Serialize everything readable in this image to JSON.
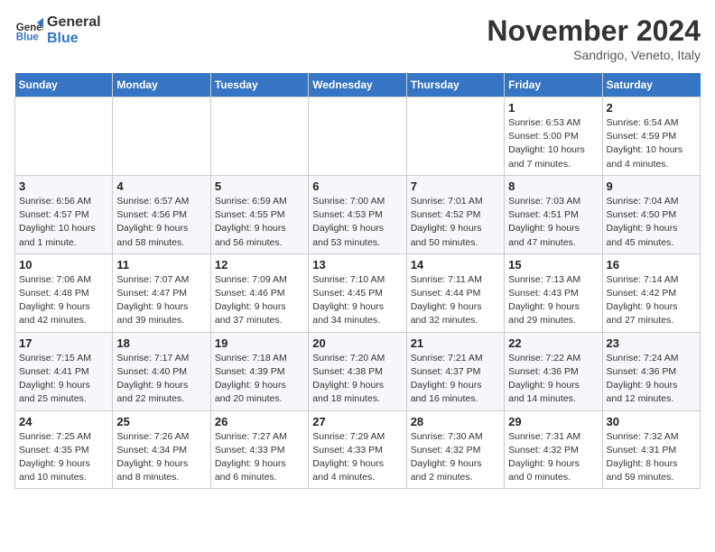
{
  "logo": {
    "line1": "General",
    "line2": "Blue"
  },
  "title": "November 2024",
  "location": "Sandrigo, Veneto, Italy",
  "weekdays": [
    "Sunday",
    "Monday",
    "Tuesday",
    "Wednesday",
    "Thursday",
    "Friday",
    "Saturday"
  ],
  "weeks": [
    [
      {
        "day": "",
        "info": ""
      },
      {
        "day": "",
        "info": ""
      },
      {
        "day": "",
        "info": ""
      },
      {
        "day": "",
        "info": ""
      },
      {
        "day": "",
        "info": ""
      },
      {
        "day": "1",
        "info": "Sunrise: 6:53 AM\nSunset: 5:00 PM\nDaylight: 10 hours\nand 7 minutes."
      },
      {
        "day": "2",
        "info": "Sunrise: 6:54 AM\nSunset: 4:59 PM\nDaylight: 10 hours\nand 4 minutes."
      }
    ],
    [
      {
        "day": "3",
        "info": "Sunrise: 6:56 AM\nSunset: 4:57 PM\nDaylight: 10 hours\nand 1 minute."
      },
      {
        "day": "4",
        "info": "Sunrise: 6:57 AM\nSunset: 4:56 PM\nDaylight: 9 hours\nand 58 minutes."
      },
      {
        "day": "5",
        "info": "Sunrise: 6:59 AM\nSunset: 4:55 PM\nDaylight: 9 hours\nand 56 minutes."
      },
      {
        "day": "6",
        "info": "Sunrise: 7:00 AM\nSunset: 4:53 PM\nDaylight: 9 hours\nand 53 minutes."
      },
      {
        "day": "7",
        "info": "Sunrise: 7:01 AM\nSunset: 4:52 PM\nDaylight: 9 hours\nand 50 minutes."
      },
      {
        "day": "8",
        "info": "Sunrise: 7:03 AM\nSunset: 4:51 PM\nDaylight: 9 hours\nand 47 minutes."
      },
      {
        "day": "9",
        "info": "Sunrise: 7:04 AM\nSunset: 4:50 PM\nDaylight: 9 hours\nand 45 minutes."
      }
    ],
    [
      {
        "day": "10",
        "info": "Sunrise: 7:06 AM\nSunset: 4:48 PM\nDaylight: 9 hours\nand 42 minutes."
      },
      {
        "day": "11",
        "info": "Sunrise: 7:07 AM\nSunset: 4:47 PM\nDaylight: 9 hours\nand 39 minutes."
      },
      {
        "day": "12",
        "info": "Sunrise: 7:09 AM\nSunset: 4:46 PM\nDaylight: 9 hours\nand 37 minutes."
      },
      {
        "day": "13",
        "info": "Sunrise: 7:10 AM\nSunset: 4:45 PM\nDaylight: 9 hours\nand 34 minutes."
      },
      {
        "day": "14",
        "info": "Sunrise: 7:11 AM\nSunset: 4:44 PM\nDaylight: 9 hours\nand 32 minutes."
      },
      {
        "day": "15",
        "info": "Sunrise: 7:13 AM\nSunset: 4:43 PM\nDaylight: 9 hours\nand 29 minutes."
      },
      {
        "day": "16",
        "info": "Sunrise: 7:14 AM\nSunset: 4:42 PM\nDaylight: 9 hours\nand 27 minutes."
      }
    ],
    [
      {
        "day": "17",
        "info": "Sunrise: 7:15 AM\nSunset: 4:41 PM\nDaylight: 9 hours\nand 25 minutes."
      },
      {
        "day": "18",
        "info": "Sunrise: 7:17 AM\nSunset: 4:40 PM\nDaylight: 9 hours\nand 22 minutes."
      },
      {
        "day": "19",
        "info": "Sunrise: 7:18 AM\nSunset: 4:39 PM\nDaylight: 9 hours\nand 20 minutes."
      },
      {
        "day": "20",
        "info": "Sunrise: 7:20 AM\nSunset: 4:38 PM\nDaylight: 9 hours\nand 18 minutes."
      },
      {
        "day": "21",
        "info": "Sunrise: 7:21 AM\nSunset: 4:37 PM\nDaylight: 9 hours\nand 16 minutes."
      },
      {
        "day": "22",
        "info": "Sunrise: 7:22 AM\nSunset: 4:36 PM\nDaylight: 9 hours\nand 14 minutes."
      },
      {
        "day": "23",
        "info": "Sunrise: 7:24 AM\nSunset: 4:36 PM\nDaylight: 9 hours\nand 12 minutes."
      }
    ],
    [
      {
        "day": "24",
        "info": "Sunrise: 7:25 AM\nSunset: 4:35 PM\nDaylight: 9 hours\nand 10 minutes."
      },
      {
        "day": "25",
        "info": "Sunrise: 7:26 AM\nSunset: 4:34 PM\nDaylight: 9 hours\nand 8 minutes."
      },
      {
        "day": "26",
        "info": "Sunrise: 7:27 AM\nSunset: 4:33 PM\nDaylight: 9 hours\nand 6 minutes."
      },
      {
        "day": "27",
        "info": "Sunrise: 7:29 AM\nSunset: 4:33 PM\nDaylight: 9 hours\nand 4 minutes."
      },
      {
        "day": "28",
        "info": "Sunrise: 7:30 AM\nSunset: 4:32 PM\nDaylight: 9 hours\nand 2 minutes."
      },
      {
        "day": "29",
        "info": "Sunrise: 7:31 AM\nSunset: 4:32 PM\nDaylight: 9 hours\nand 0 minutes."
      },
      {
        "day": "30",
        "info": "Sunrise: 7:32 AM\nSunset: 4:31 PM\nDaylight: 8 hours\nand 59 minutes."
      }
    ]
  ]
}
